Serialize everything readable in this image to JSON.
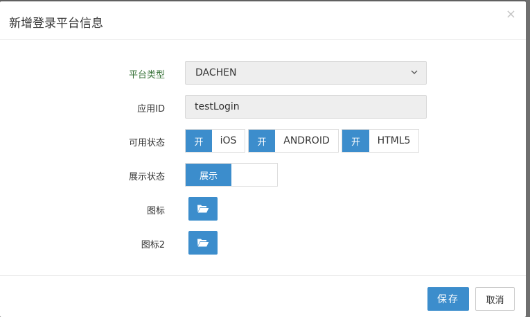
{
  "modal": {
    "title": "新增登录平台信息",
    "close_glyph": "×"
  },
  "form": {
    "platform_type": {
      "label": "平台类型",
      "value": "DACHEN"
    },
    "app_id": {
      "label": "应用ID",
      "value": "testLogin"
    },
    "available_status": {
      "label": "可用状态",
      "toggles": [
        {
          "state": "开",
          "name": "iOS",
          "on": true
        },
        {
          "state": "开",
          "name": "ANDROID",
          "on": true
        },
        {
          "state": "开",
          "name": "HTML5",
          "on": true
        }
      ]
    },
    "display_status": {
      "label": "展示状态",
      "state": "展示",
      "on": true
    },
    "icon": {
      "label": "图标",
      "icon": "folder-open-icon"
    },
    "icon2": {
      "label": "图标2",
      "icon": "folder-open-icon"
    }
  },
  "footer": {
    "save_label": "保存",
    "cancel_label": "取消"
  },
  "colors": {
    "accent": "#3c8dcc",
    "label_highlight": "#3c763d"
  }
}
